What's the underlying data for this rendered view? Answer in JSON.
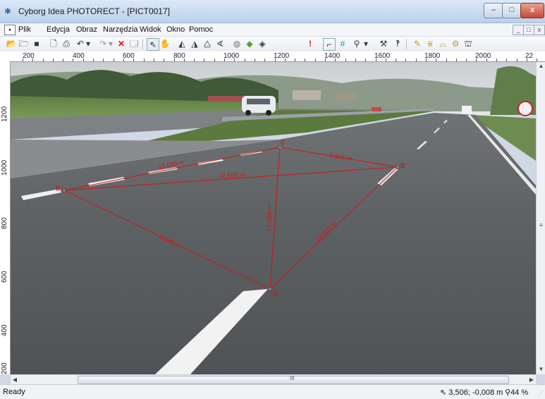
{
  "window": {
    "title": "Cyborg Idea PHOTORECT - [PICT0017]",
    "controls": {
      "minimize": "–",
      "maximize": "□",
      "close": "x"
    }
  },
  "menu": {
    "items": [
      "Plik",
      "Edycja",
      "Obraz",
      "Narzędzia",
      "Widok",
      "Okno",
      "Pomoc"
    ],
    "mdi_controls": [
      "_",
      "□",
      "x"
    ]
  },
  "toolbar": {
    "icons": [
      "open-icon",
      "save-as-icon",
      "save-icon",
      "print-preview-icon",
      "print-icon",
      "undo-icon",
      "undo-dropdown-icon",
      "redo-icon",
      "redo-dropdown-icon",
      "delete-icon",
      "properties-icon",
      "select-icon",
      "hand-icon",
      "perspective-icon",
      "rectify-icon",
      "mirror-icon",
      "angle-icon",
      "circle-icon",
      "map-icon",
      "shape-icon",
      "warning-icon",
      "frame-icon",
      "grid-icon",
      "zoom-icon",
      "zoom-dropdown-icon",
      "tools-icon",
      "help-icon",
      "pencil-icon",
      "measure-icon",
      "dome-icon",
      "gear-icon",
      "stamp-icon"
    ]
  },
  "rulers": {
    "horizontal": [
      "200",
      "400",
      "600",
      "800",
      "1000",
      "1200",
      "1400",
      "1600",
      "1800",
      "2000",
      "22"
    ],
    "vertical": [
      "1200",
      "1000",
      "800",
      "600",
      "400",
      "200"
    ]
  },
  "measurements": {
    "points": [
      "B",
      "C",
      "D",
      "A"
    ],
    "edges": [
      {
        "label": "12,000 m"
      },
      {
        "label": "3,501 m"
      },
      {
        "label": "12,500 m"
      },
      {
        "label": "3,501 m"
      },
      {
        "label": "12,000 m"
      },
      {
        "label": "12,500 m"
      }
    ],
    "line_color": "#d41414"
  },
  "scrollbar": {
    "thumb_grip": "III"
  },
  "status": {
    "text": "Ready",
    "coordinates": "3,506; -0,008 m",
    "zoom": "44 %"
  }
}
